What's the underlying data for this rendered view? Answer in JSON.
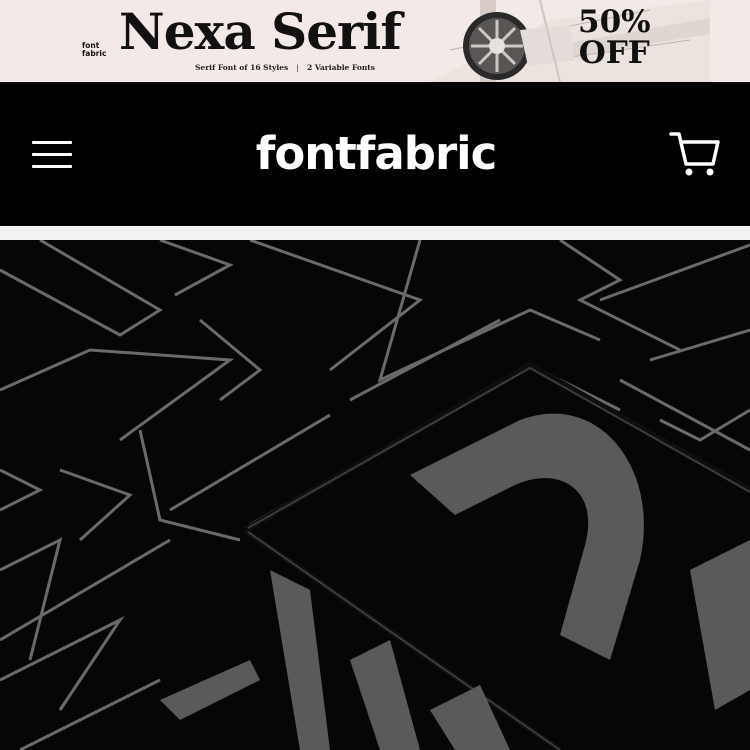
{
  "promo": {
    "brand_line1": "font",
    "brand_line2": "fabric",
    "title": "Nexa Serif",
    "subtitle_styles": "Serif Font of 16 Styles",
    "subtitle_separator": "|",
    "subtitle_variable": "2 Variable Fonts",
    "offer_line1": "50%",
    "offer_line2": "OFF"
  },
  "header": {
    "menu_icon": "hamburger-menu-icon",
    "brand": "fontfabric",
    "cart_icon": "shopping-cart-icon"
  },
  "hero": {
    "pattern_letters": [
      "A",
      "D",
      "W"
    ]
  },
  "colors": {
    "promo_bg": "#f3e9e6",
    "header_bg": "#000000",
    "hero_bg": "#060606",
    "hero_letter_gray": "#5a5a5a"
  }
}
